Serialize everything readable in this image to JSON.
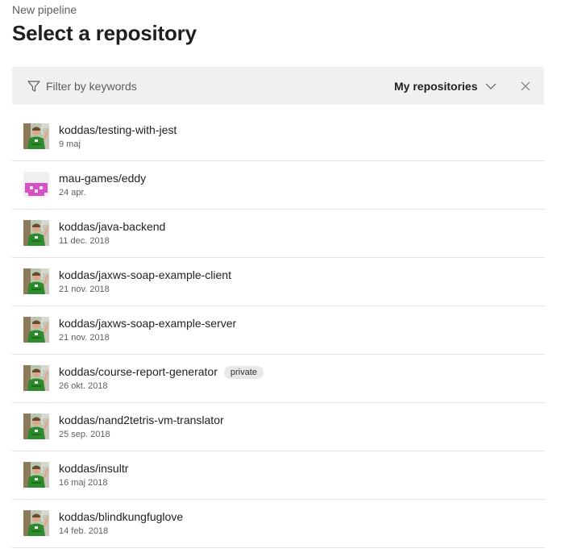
{
  "header": {
    "breadcrumb": "New pipeline",
    "title": "Select a repository"
  },
  "filter": {
    "placeholder": "Filter by keywords",
    "scope_label": "My repositories",
    "filter_icon": "filter-icon",
    "dropdown_icon": "chevron-down-icon",
    "clear_icon": "close-icon"
  },
  "repositories": [
    {
      "name": "koddas/testing-with-jest",
      "date": "9 maj",
      "avatar": "user-photo",
      "badge": ""
    },
    {
      "name": "mau-games/eddy",
      "date": "24 apr.",
      "avatar": "identicon",
      "badge": ""
    },
    {
      "name": "koddas/java-backend",
      "date": "11 dec. 2018",
      "avatar": "user-photo",
      "badge": ""
    },
    {
      "name": "koddas/jaxws-soap-example-client",
      "date": "21 nov. 2018",
      "avatar": "user-photo",
      "badge": ""
    },
    {
      "name": "koddas/jaxws-soap-example-server",
      "date": "21 nov. 2018",
      "avatar": "user-photo",
      "badge": ""
    },
    {
      "name": "koddas/course-report-generator",
      "date": "26 okt. 2018",
      "avatar": "user-photo",
      "badge": "private"
    },
    {
      "name": "koddas/nand2tetris-vm-translator",
      "date": "25 sep. 2018",
      "avatar": "user-photo",
      "badge": ""
    },
    {
      "name": "koddas/insultr",
      "date": "16 maj 2018",
      "avatar": "user-photo",
      "badge": ""
    },
    {
      "name": "koddas/blindkungfuglove",
      "date": "14 feb. 2018",
      "avatar": "user-photo",
      "badge": ""
    }
  ],
  "colors": {
    "filter_bar_bg": "#f0f0f0",
    "divider": "#e1dfdd",
    "identicon": "#d94fc8",
    "avatar_shirt": "#2e8b2e"
  }
}
